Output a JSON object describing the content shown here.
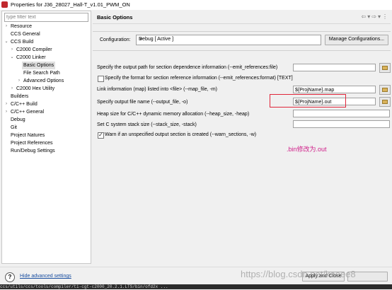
{
  "window": {
    "title": "Properties for J36_28027_Hall-T_v1.01_PWM_ON"
  },
  "filter": {
    "placeholder": "type filter text"
  },
  "tree": [
    {
      "label": "Resource",
      "arrow": "›"
    },
    {
      "label": "CCS General",
      "arrow": ""
    },
    {
      "label": "CCS Build",
      "arrow": "⌄"
    },
    {
      "label": "C2000 Compiler",
      "arrow": "›"
    },
    {
      "label": "C2000 Linker",
      "arrow": "⌄"
    },
    {
      "label": "Basic Options",
      "arrow": ""
    },
    {
      "label": "File Search Path",
      "arrow": ""
    },
    {
      "label": "Advanced Options",
      "arrow": "›"
    },
    {
      "label": "C2000 Hex Utility",
      "arrow": "›"
    },
    {
      "label": "Builders",
      "arrow": ""
    },
    {
      "label": "C/C++ Build",
      "arrow": "›"
    },
    {
      "label": "C/C++ General",
      "arrow": "›"
    },
    {
      "label": "Debug",
      "arrow": ""
    },
    {
      "label": "Git",
      "arrow": ""
    },
    {
      "label": "Project Natures",
      "arrow": ""
    },
    {
      "label": "Project References",
      "arrow": ""
    },
    {
      "label": "Run/Debug Settings",
      "arrow": ""
    }
  ],
  "page": {
    "title": "Basic Options",
    "nav_icons": [
      "⇦",
      "▾",
      "⇨",
      "▾",
      "⋮"
    ]
  },
  "config": {
    "label": "Configuration:",
    "value": "Debug  [ Active ]",
    "manage_label": "Manage Configurations..."
  },
  "options": {
    "dep_output_label": "Specify the output path for section dependence information (--emit_references:file)",
    "dep_format_label": "Specify the format for section reference information (--emit_references:format) [TEXT]",
    "map_label": "Link information (map) listed into <file> (--map_file, -m)",
    "map_value": "${ProjName}.map",
    "output_label": "Specify output file name (--output_file, -o)",
    "output_value": "${ProjName}.out",
    "heap_label": "Heap size for C/C++ dynamic memory allocation (--heap_size, -heap)",
    "stack_label": "Set C system stack size (--stack_size, -stack)",
    "warn_label": "Warn if an unspecified output section is created (--warn_sections, -w)",
    "warn_checked": true
  },
  "annotation": ".bin修改为.out",
  "footer": {
    "help_icon": "?",
    "hide_advanced": "Hide advanced settings",
    "apply_close": "Apply and Close",
    "watermark": "https://blog.csdn.net/keeee8",
    "console_text": "ccs/utils/ccs/tools/compiler/ti-cgt-c2000_20.2.1.LTS/bin/ofd2x ..."
  }
}
